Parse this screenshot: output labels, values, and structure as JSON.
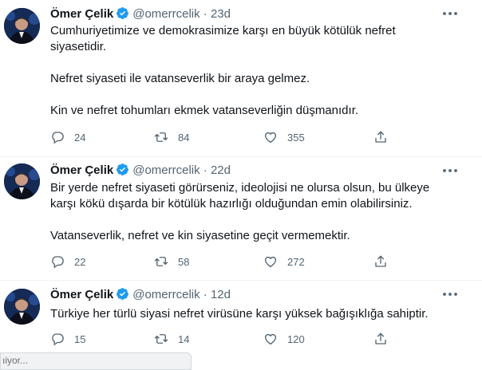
{
  "tweets": [
    {
      "name": "Ömer Çelik",
      "handle": "@omerrcelik",
      "separator": "·",
      "time": "23d",
      "text": [
        "Cumhuriyetimize ve demokrasimize karşı en büyük kötülük nefret",
        "siyasetidir.",
        "Nefret siyaseti ile vatanseverlik bir araya gelmez.",
        "Kin ve nefret tohumları ekmek vatanseverliğin düşmanıdır."
      ],
      "replies": "24",
      "retweets": "84",
      "likes": "355"
    },
    {
      "name": "Ömer Çelik",
      "handle": "@omerrcelik",
      "separator": "·",
      "time": "22d",
      "text": [
        "Bir yerde nefret siyaseti görürseniz, ideolojisi ne olursa olsun, bu ülkeye",
        "karşı kökü dışarda bir kötülük hazırlığı olduğundan emin olabilirsiniz.",
        "Vatanseverlik, nefret ve kin siyasetine geçit vermemektir."
      ],
      "replies": "22",
      "retweets": "58",
      "likes": "272"
    },
    {
      "name": "Ömer Çelik",
      "handle": "@omerrcelik",
      "separator": "·",
      "time": "12d",
      "text": [
        "Türkiye her türlü siyasi nefret virüsüne karşı yüksek bağışıklığa sahiptir."
      ],
      "replies": "15",
      "retweets": "14",
      "likes": "120"
    }
  ],
  "status_bar": {
    "text": "ıiyor..."
  },
  "icons": {
    "verified": "verified-badge-icon",
    "more": "more-options-icon",
    "reply": "reply-icon",
    "retweet": "retweet-icon",
    "like": "heart-icon",
    "share": "share-icon"
  },
  "colors": {
    "verified": "#1d9bf0",
    "muted": "#536471",
    "text": "#0f1419"
  }
}
